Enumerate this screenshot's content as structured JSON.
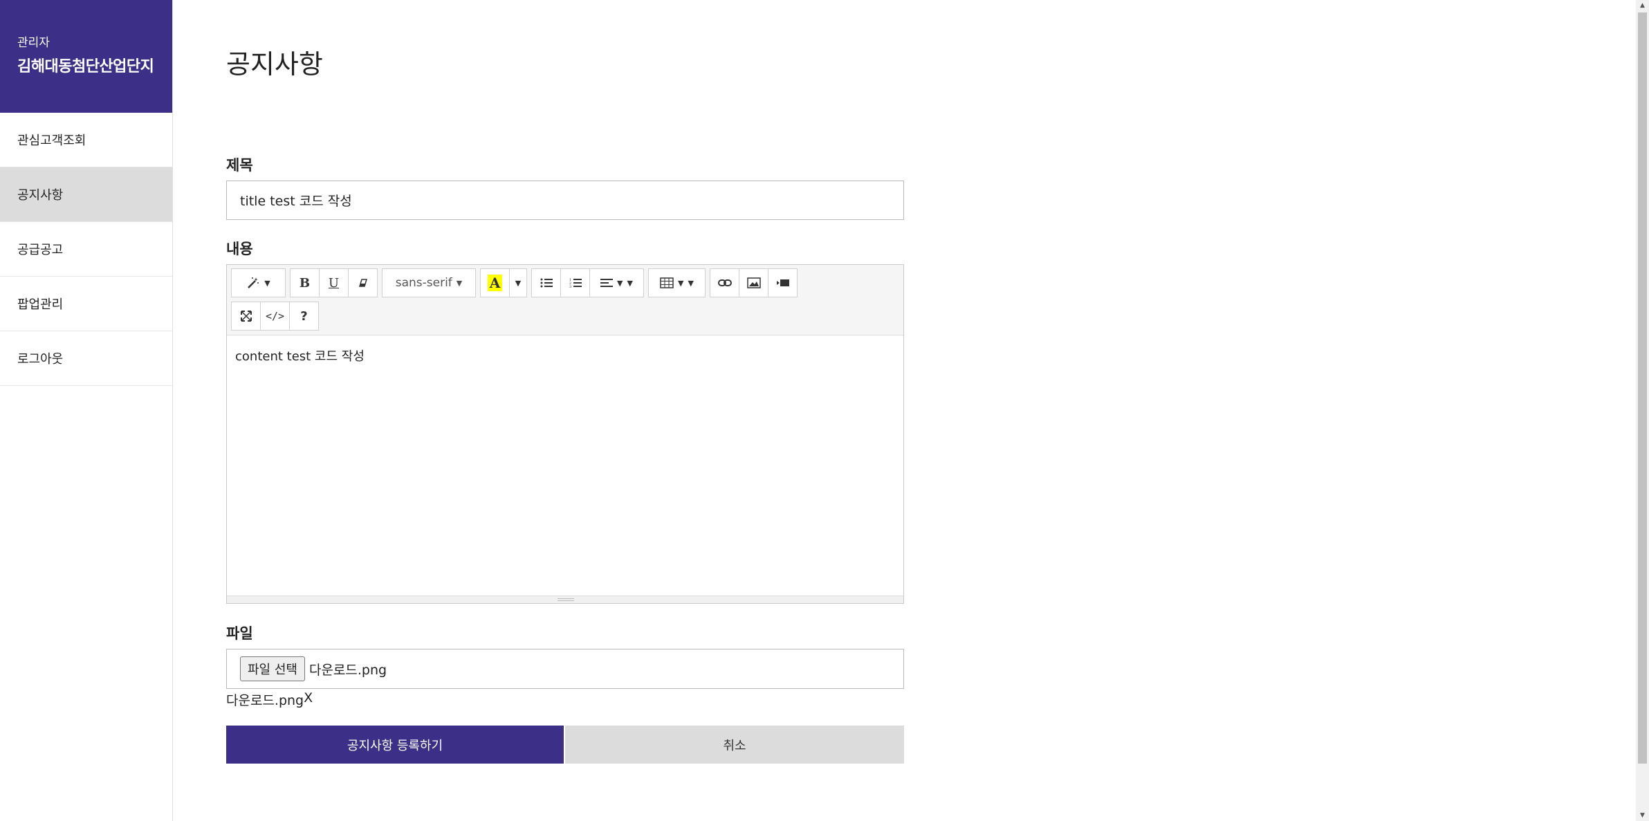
{
  "sidebar": {
    "role": "관리자",
    "org_name": "김해대동첨단산업단지",
    "items": [
      {
        "label": "관심고객조회"
      },
      {
        "label": "공지사항"
      },
      {
        "label": "공급공고"
      },
      {
        "label": "팝업관리"
      },
      {
        "label": "로그아웃"
      }
    ]
  },
  "page": {
    "title": "공지사항"
  },
  "form": {
    "title_label": "제목",
    "title_value": "title test 코드 작성",
    "content_label": "내용",
    "content_value": "content test 코드 작성",
    "file_label": "파일",
    "file_button": "파일 선택",
    "file_chosen": "다운로드.png",
    "attached_file": "다운로드.png",
    "attached_remove": "X",
    "submit_label": "공지사항 등록하기",
    "cancel_label": "취소"
  },
  "toolbar": {
    "font_name": "sans-serif",
    "bold": "B",
    "underline": "U",
    "help": "?",
    "code": "</>",
    "highlight_color": "#ffff00",
    "icons": [
      "magic-icon",
      "eraser-icon",
      "bullet-list-icon",
      "ordered-list-icon",
      "align-icon",
      "table-icon",
      "link-icon",
      "image-icon",
      "video-icon",
      "fullscreen-icon",
      "code-view-icon",
      "help-icon"
    ]
  },
  "colors": {
    "brand": "#3b2f87",
    "active_nav": "#dcdcdc"
  }
}
